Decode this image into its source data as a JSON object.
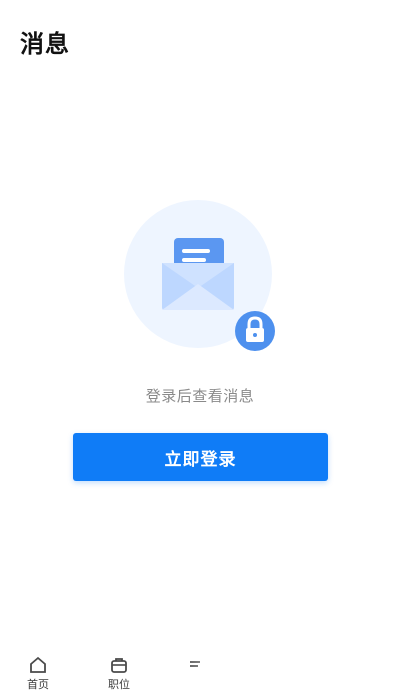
{
  "header": {
    "title": "消息"
  },
  "empty_state": {
    "illustration_icon": "envelope-lock-icon",
    "message": "登录后查看消息"
  },
  "actions": {
    "login_label": "立即登录"
  },
  "bottom_nav": {
    "items": [
      {
        "label": "首页",
        "icon": "home-icon"
      },
      {
        "label": "职位",
        "icon": "briefcase-icon"
      },
      {
        "label": "",
        "icon": "partial-icon"
      }
    ]
  },
  "colors": {
    "primary": "#0f7cf7",
    "text": "#111111",
    "muted": "#8a8a8a",
    "illustration_bg": "#eef5ff",
    "lock_badge": "#4d90ee"
  }
}
